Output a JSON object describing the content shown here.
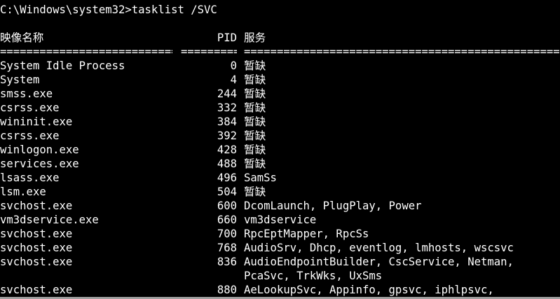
{
  "console": {
    "command": "C:\\Windows\\system32>tasklist /SVC",
    "headers": {
      "name": "映像名称",
      "pid": "PID",
      "services": "服务"
    },
    "separator": {
      "name": "========================================",
      "pid": "==========",
      "services": "==========================================================="
    },
    "rows": [
      {
        "name": "System Idle Process",
        "pid": "0",
        "services": "暂缺"
      },
      {
        "name": "System",
        "pid": "4",
        "services": "暂缺"
      },
      {
        "name": "smss.exe",
        "pid": "244",
        "services": "暂缺"
      },
      {
        "name": "csrss.exe",
        "pid": "332",
        "services": "暂缺"
      },
      {
        "name": "wininit.exe",
        "pid": "384",
        "services": "暂缺"
      },
      {
        "name": "csrss.exe",
        "pid": "392",
        "services": "暂缺"
      },
      {
        "name": "winlogon.exe",
        "pid": "428",
        "services": "暂缺"
      },
      {
        "name": "services.exe",
        "pid": "488",
        "services": "暂缺"
      },
      {
        "name": "lsass.exe",
        "pid": "496",
        "services": "SamSs"
      },
      {
        "name": "lsm.exe",
        "pid": "504",
        "services": "暂缺"
      },
      {
        "name": "svchost.exe",
        "pid": "600",
        "services": "DcomLaunch, PlugPlay, Power"
      },
      {
        "name": "vm3dservice.exe",
        "pid": "660",
        "services": "vm3dservice"
      },
      {
        "name": "svchost.exe",
        "pid": "700",
        "services": "RpcEptMapper, RpcSs"
      },
      {
        "name": "svchost.exe",
        "pid": "768",
        "services": "AudioSrv, Dhcp, eventlog, lmhosts, wscsvc"
      },
      {
        "name": "svchost.exe",
        "pid": "836",
        "services": "AudioEndpointBuilder, CscService, Netman,"
      },
      {
        "name": "",
        "pid": "",
        "services": "PcaSvc, TrkWks, UxSms"
      },
      {
        "name": "svchost.exe",
        "pid": "880",
        "services": "AeLookupSvc, Appinfo, gpsvc, iphlpsvc,"
      }
    ]
  }
}
